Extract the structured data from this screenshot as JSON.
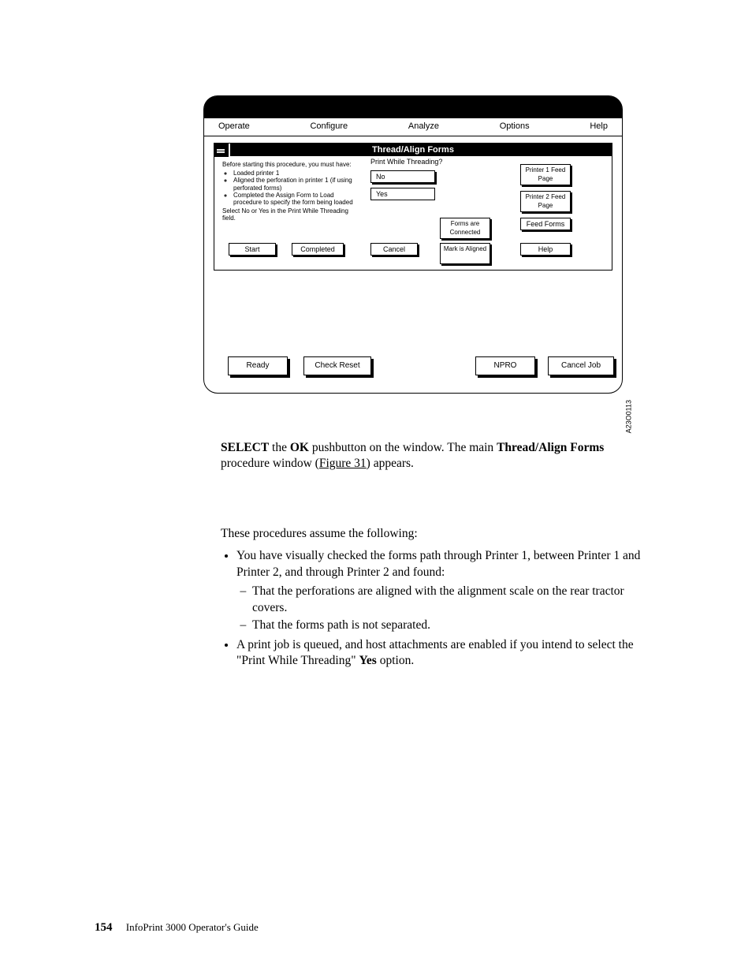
{
  "menu": {
    "operate": "Operate",
    "configure": "Configure",
    "analyze": "Analyze",
    "options": "Options",
    "help": "Help"
  },
  "dialog": {
    "title": "Thread/Align Forms",
    "instructions_intro": "Before starting this procedure, you must have:",
    "instructions": [
      "Loaded printer 1",
      "Aligned the perforation in printer 1 (if using perforated forms)",
      "Completed the Assign Form to Load procedure to specify the form being loaded"
    ],
    "instructions_end": "Select No or Yes in the Print While Threading field.",
    "pwthreading_label": "Print While Threading?",
    "no": "No",
    "yes": "Yes",
    "forms_connected": "Forms are Connected",
    "mark_aligned": "Mark is Aligned",
    "p1_feed": "Printer 1 Feed Page",
    "p2_feed": "Printer 2 Feed Page",
    "feed_forms": "Feed Forms",
    "help": "Help",
    "start": "Start",
    "completed": "Completed",
    "cancel": "Cancel"
  },
  "bottom": {
    "ready": "Ready",
    "check_reset": "Check Reset",
    "npro": "NPRO",
    "cancel_job": "Cancel Job"
  },
  "figure_id": "A23O0113",
  "text": {
    "p1a": "SELECT",
    "p1b": " the ",
    "p1c": "OK",
    "p1d": " pushbutton on the window. The main ",
    "p1e": "Thread/Align Forms",
    "p1f": " procedure window (",
    "p1g": "Figure 31",
    "p1h": ") appears.",
    "p2": "These procedures assume the following:",
    "b1": "You have visually checked the forms path through Printer 1, between Printer 1 and Printer 2, and through Printer 2 and found:",
    "b1a": "That the perforations are aligned with the alignment scale on the rear tractor covers.",
    "b1b": "That the forms path is not separated.",
    "b2a": "A print job is queued, and host attachments are enabled if you intend to select the \"Print While Threading\" ",
    "b2b": "Yes",
    "b2c": " option."
  },
  "footer": {
    "page": "154",
    "book": "InfoPrint 3000 Operator's Guide"
  }
}
